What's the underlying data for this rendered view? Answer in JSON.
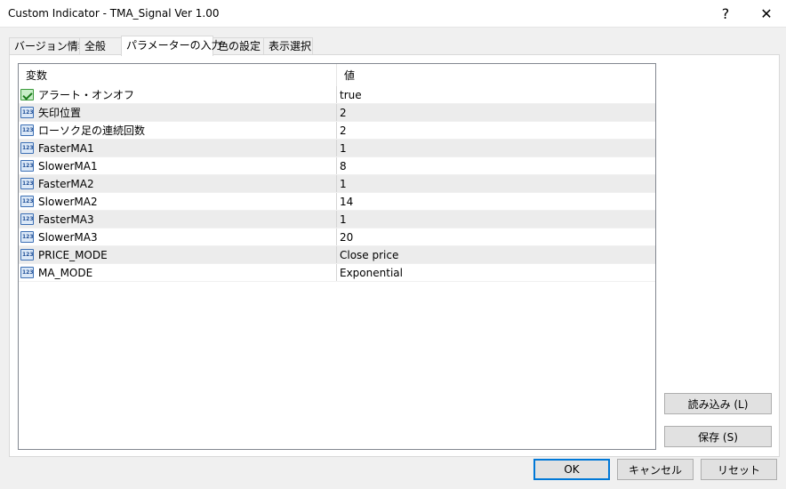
{
  "window": {
    "title": "Custom Indicator - TMA_Signal  Ver  1.00",
    "help_glyph": "?",
    "close_glyph": "✕"
  },
  "tabs": [
    {
      "label": "バージョン情報",
      "active": false
    },
    {
      "label": "全般",
      "active": false
    },
    {
      "label": "パラメーターの入力",
      "active": true
    },
    {
      "label": "色の設定",
      "active": false
    },
    {
      "label": "表示選択",
      "active": false
    }
  ],
  "grid": {
    "headers": {
      "name": "変数",
      "value": "値"
    },
    "rows": [
      {
        "icon": "boolean-icon",
        "name": "アラート・オンオフ",
        "value": "true"
      },
      {
        "icon": "number-icon",
        "name": "矢印位置",
        "value": "2"
      },
      {
        "icon": "number-icon",
        "name": "ローソク足の連続回数",
        "value": "2"
      },
      {
        "icon": "number-icon",
        "name": "FasterMA1",
        "value": "1"
      },
      {
        "icon": "number-icon",
        "name": "SlowerMA1",
        "value": "8"
      },
      {
        "icon": "number-icon",
        "name": "FasterMA2",
        "value": "1"
      },
      {
        "icon": "number-icon",
        "name": "SlowerMA2",
        "value": "14"
      },
      {
        "icon": "number-icon",
        "name": "FasterMA3",
        "value": "1"
      },
      {
        "icon": "number-icon",
        "name": "SlowerMA3",
        "value": "20"
      },
      {
        "icon": "number-icon",
        "name": "PRICE_MODE",
        "value": "Close price"
      },
      {
        "icon": "number-icon",
        "name": "MA_MODE",
        "value": "Exponential"
      }
    ]
  },
  "side_buttons": {
    "load": "読み込み (L)",
    "save": "保存 (S)"
  },
  "footer_buttons": {
    "ok": "OK",
    "cancel": "キャンセル",
    "reset": "リセット"
  },
  "colors": {
    "accent": "#0078d7",
    "alt_row": "#ececec"
  }
}
